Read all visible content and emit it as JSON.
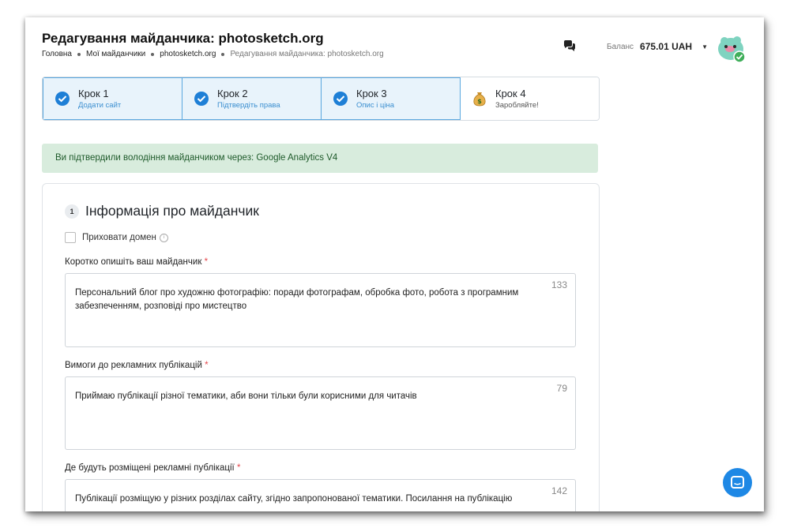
{
  "header": {
    "title": "Редагування майданчика: photosketch.org",
    "breadcrumb": [
      "Головна",
      "Мої майданчики",
      "photosketch.org",
      "Редагування майданчика: photosketch.org"
    ],
    "balance_label": "Баланс",
    "balance_value": "675.01 UAH"
  },
  "steps": [
    {
      "name": "Крок 1",
      "sub": "Додати сайт",
      "state": "done"
    },
    {
      "name": "Крок 2",
      "sub": "Підтвердіть права",
      "state": "done"
    },
    {
      "name": "Крок 3",
      "sub": "Опис і ціна",
      "state": "done"
    },
    {
      "name": "Крок 4",
      "sub": "Заробляйте!",
      "state": "pending",
      "icon": "money-bag-icon"
    }
  ],
  "alert": "Ви підтвердили володіння майданчиком через: Google Analytics V4",
  "section": {
    "number": "1",
    "title": "Інформація про майданчик",
    "hide_domain_label": "Приховати домен",
    "fields": [
      {
        "label": "Коротко опишіть ваш майданчик",
        "required": "*",
        "value": "Персональний блог про художню фотографію: поради фотографам, обробка фото, робота з програмним забезпеченням, розповіді про мистецтво",
        "count": "133"
      },
      {
        "label": "Вимоги до рекламних публікацій",
        "required": "*",
        "value": "Приймаю  публікації різної тематики, аби вони тільки були корисними для читачів",
        "count": "79"
      },
      {
        "label": "Де будуть розміщені рекламні публікації",
        "required": "*",
        "value": "Публікації розміщую у різних розділах сайту, згідно запропонованої тематики. Посилання на публікацію",
        "count": "142"
      }
    ]
  },
  "colors": {
    "accent": "#3c8fd0",
    "success_bg": "#d8ecdd",
    "help_button": "#1e88e5"
  }
}
